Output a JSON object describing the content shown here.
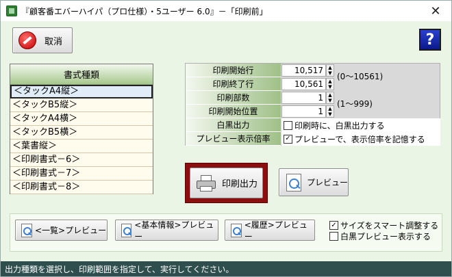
{
  "window": {
    "title": "『顧客番エバーハイパ（プロ仕様）・5ユーザー 6.0』－「印刷前」",
    "close_glyph": "✕"
  },
  "toolbar": {
    "cancel_label": "取消",
    "help_label": "?"
  },
  "format_list": {
    "header": "書式種類",
    "items": [
      "＜タックA4縦＞",
      "＜タックB5縦＞",
      "＜タックA4横＞",
      "＜タックB5横＞",
      "＜葉書縦＞",
      "＜印刷書式－6＞",
      "＜印刷書式－7＞",
      "＜印刷書式－8＞"
    ],
    "selected_index": 0
  },
  "settings": {
    "start_row_label": "印刷開始行",
    "start_row_value": "10,517",
    "end_row_label": "印刷終了行",
    "end_row_value": "10,561",
    "row_range": "(0～10561)",
    "copies_label": "印刷部数",
    "copies_value": "1",
    "start_position_label": "印刷開始位置",
    "start_position_value": "1",
    "copies_range": "(1～999)",
    "monochrome_label": "白黒出力",
    "monochrome_text": "印刷時に、白黒出力する",
    "monochrome_checked": false,
    "preview_zoom_label": "プレビュー表示倍率",
    "preview_zoom_text": "プレビューで、表示倍率を記憶する",
    "preview_zoom_checked": true
  },
  "actions": {
    "print_label": "印刷出力",
    "preview_label": "プレビュー"
  },
  "bottom": {
    "list_preview_label": "<一覧>プレビュー",
    "basic_preview_label": "<基本情報>プレビュー",
    "history_preview_label": "<履歴>プレビュー",
    "smart_size_text": "サイズをスマート調整する",
    "smart_size_checked": true,
    "mono_preview_text": "白黒プレビュー表示する",
    "mono_preview_checked": false
  },
  "status": {
    "message": "出力種類を選択し、印刷範囲を指定して、実行してください。"
  },
  "glyphs": {
    "check": "✓",
    "spin_up": "▲",
    "spin_down": "▼"
  },
  "colors": {
    "window_bg": "#eaf5e6",
    "status_bg": "#2f4f4f",
    "print_frame": "#8b0f0f",
    "header_green": "#a6c88c"
  }
}
